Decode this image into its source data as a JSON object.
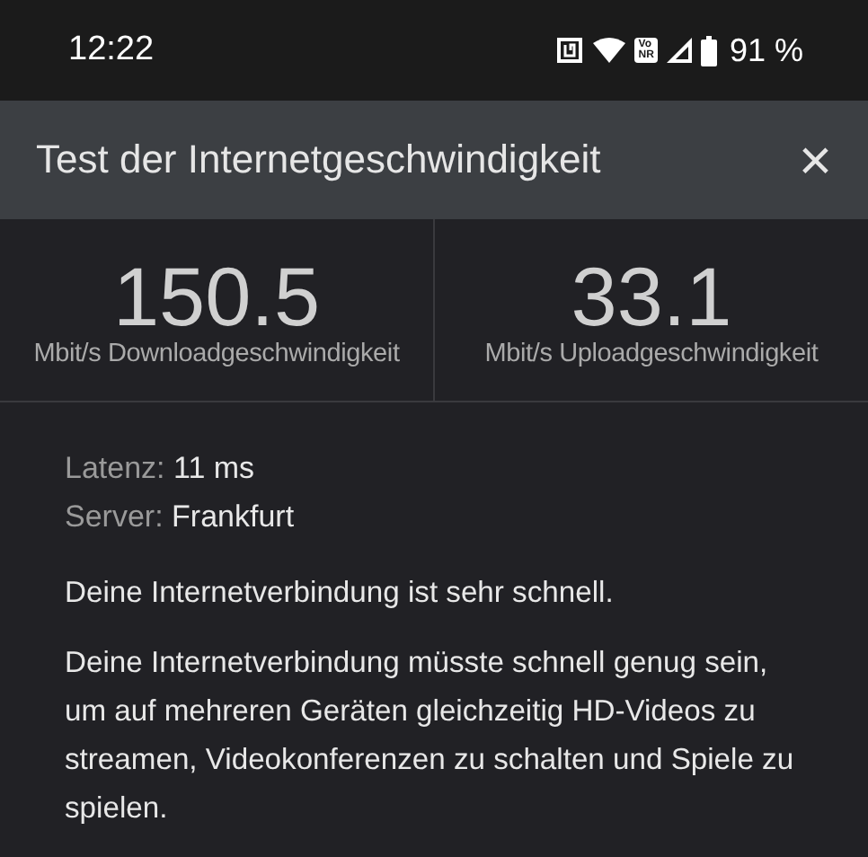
{
  "status_bar": {
    "time": "12:22",
    "network_badge": [
      "Vo",
      "NR"
    ],
    "battery": "91 %"
  },
  "header": {
    "title": "Test der Internetgeschwindigkeit",
    "close": "×"
  },
  "metrics": [
    {
      "value": "150.5",
      "label": "Mbit/s Downloadgeschwindigkeit"
    },
    {
      "value": "33.1",
      "label": "Mbit/s Uploadgeschwindigkeit"
    }
  ],
  "details": [
    {
      "label": "Latenz:",
      "value": "11 ms"
    },
    {
      "label": "Server:",
      "value": "Frankfurt"
    }
  ],
  "paragraphs": [
    "Deine Internetverbindung ist sehr schnell.",
    "Deine Internetverbindung müsste schnell genug sein, um auf mehreren Geräten gleichzeitig HD-Videos zu streamen, Videokonferenzen zu schalten und Spiele zu spielen."
  ]
}
